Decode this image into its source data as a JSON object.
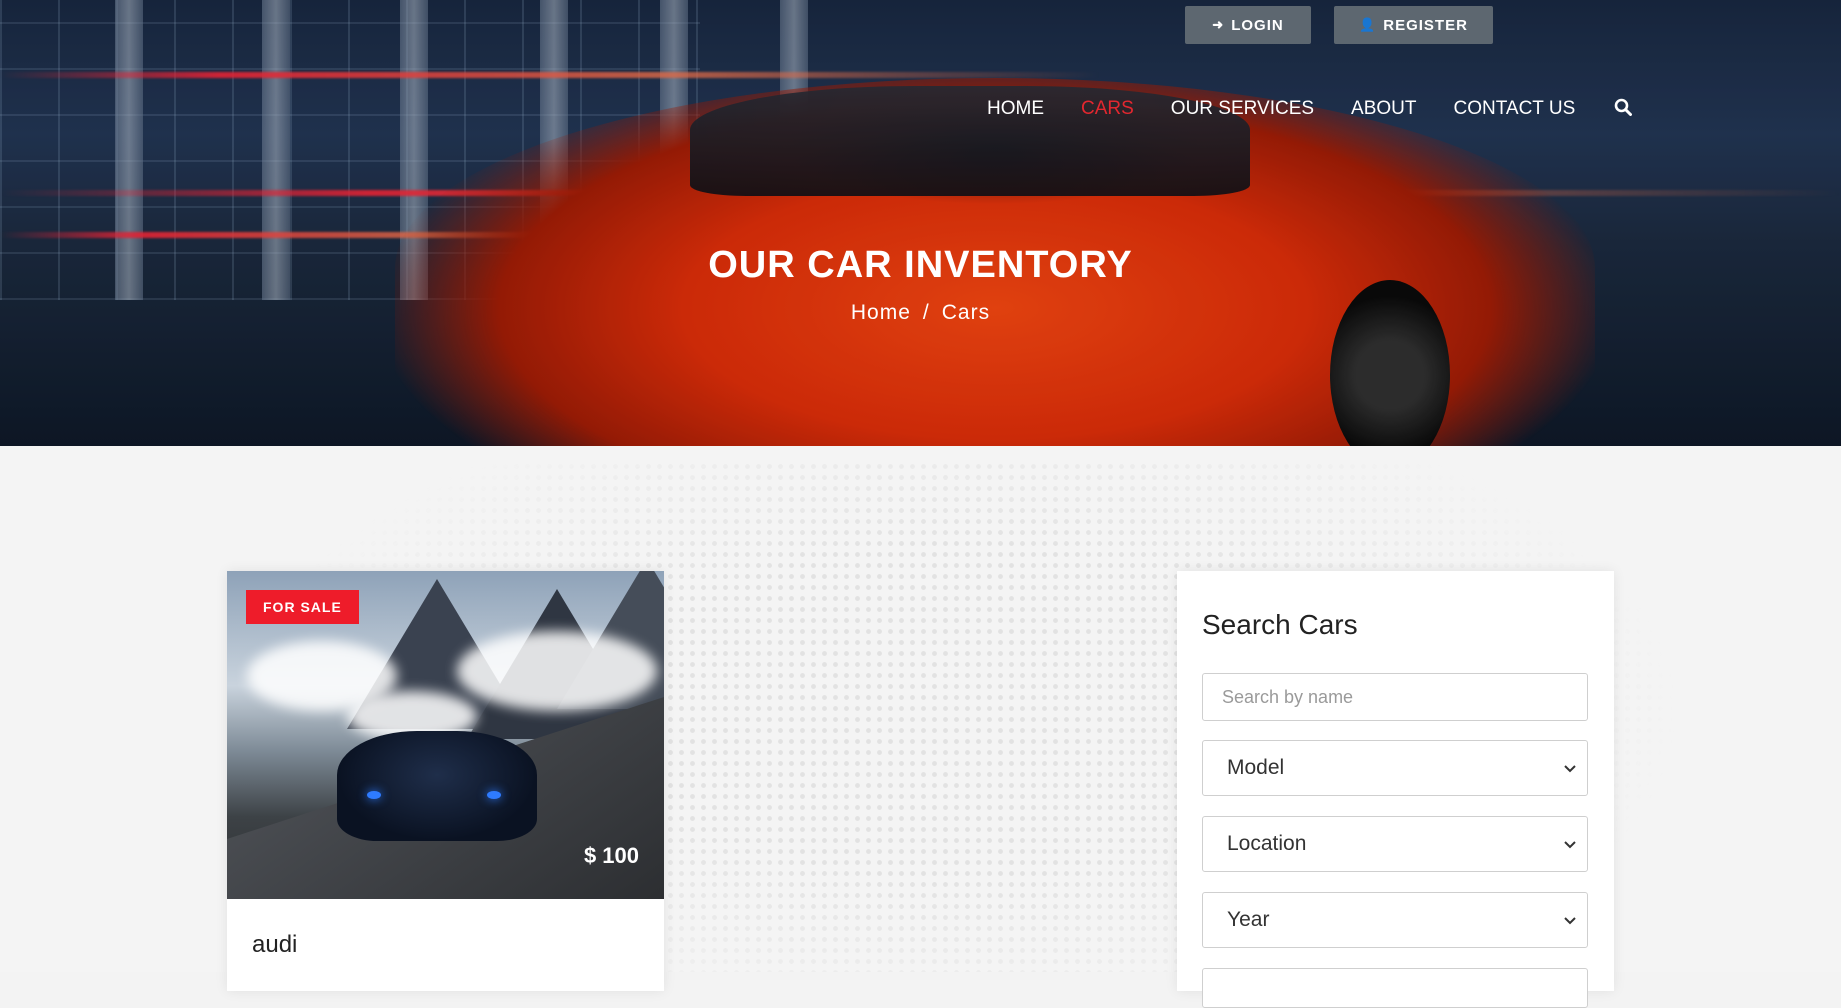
{
  "auth": {
    "login_label": "LOGIN",
    "register_label": "REGISTER"
  },
  "nav": {
    "items": [
      {
        "label": "HOME",
        "active": false
      },
      {
        "label": "CARS",
        "active": true
      },
      {
        "label": "OUR SERVICES",
        "active": false
      },
      {
        "label": "ABOUT",
        "active": false
      },
      {
        "label": "CONTACT US",
        "active": false
      }
    ],
    "search_icon": "search-icon"
  },
  "hero": {
    "title": "OUR CAR INVENTORY",
    "breadcrumb": [
      "Home",
      "/",
      "Cars"
    ]
  },
  "listing": {
    "badge": "FOR SALE",
    "price": "$ 100",
    "name": "audi"
  },
  "search_panel": {
    "title": "Search Cars",
    "name_placeholder": "Search by name",
    "model_selected": "Model",
    "location_selected": "Location",
    "year_selected": "Year"
  },
  "colors": {
    "accent": "#ee1c2a",
    "nav_active": "#e3272f",
    "button_bg": "#5d6770"
  }
}
